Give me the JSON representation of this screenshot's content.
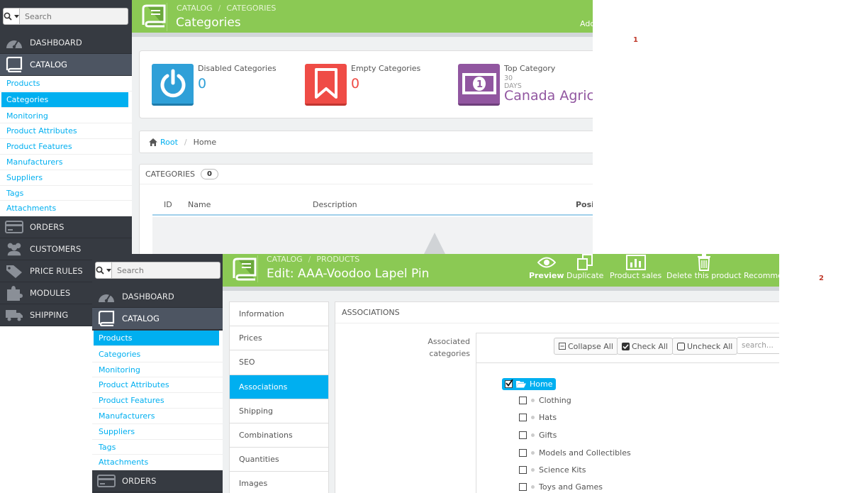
{
  "markers": [
    "1",
    "2"
  ],
  "shot1": {
    "search_placeholder": "Search",
    "menu": [
      {
        "label": "DASHBOARD",
        "icon": "dashboard-icon"
      },
      {
        "label": "CATALOG",
        "icon": "book-icon"
      }
    ],
    "submenu": [
      "Products",
      "Categories",
      "Monitoring",
      "Product Attributes",
      "Product Features",
      "Manufacturers",
      "Suppliers",
      "Tags",
      "Attachments"
    ],
    "submenu_selected": "Categories",
    "menu_bottom": [
      "ORDERS",
      "CUSTOMERS",
      "PRICE RULES",
      "MODULES",
      "SHIPPING"
    ],
    "breadcrumb": [
      "CATALOG",
      "CATEGORIES"
    ],
    "title": "Categories",
    "toolbar_partial": "Add",
    "kpis": [
      {
        "title": "Disabled Categories",
        "value": "0",
        "color": "#2fa0d8",
        "icon": "power-icon"
      },
      {
        "title": "Empty Categories",
        "value": "0",
        "color": "#ef4c46",
        "icon": "bookmark-icon"
      },
      {
        "title": "Top Category",
        "sub": "30 DAYS",
        "value": "Canada Agric..",
        "color": "#9156a0",
        "icon": "money-icon"
      }
    ],
    "path": {
      "root": "Root",
      "current": "Home"
    },
    "list": {
      "title": "CATEGORIES",
      "count": "0",
      "columns": [
        "ID",
        "Name",
        "Description",
        "Posit"
      ]
    }
  },
  "shot2": {
    "search_placeholder": "Search",
    "menu": [
      {
        "label": "DASHBOARD",
        "icon": "dashboard-icon"
      },
      {
        "label": "CATALOG",
        "icon": "book-icon"
      }
    ],
    "submenu": [
      "Products",
      "Categories",
      "Monitoring",
      "Product Attributes",
      "Product Features",
      "Manufacturers",
      "Suppliers",
      "Tags",
      "Attachments"
    ],
    "submenu_selected": "Products",
    "menu_bottom": [
      "ORDERS"
    ],
    "breadcrumb": [
      "CATALOG",
      "PRODUCTS"
    ],
    "title": "Edit: AAA-Voodoo Lapel Pin",
    "toolbar": [
      "Preview",
      "Duplicate",
      "Product sales",
      "Delete this product",
      "Recomme"
    ],
    "tabs": [
      "Information",
      "Prices",
      "SEO",
      "Associations",
      "Shipping",
      "Combinations",
      "Quantities",
      "Images"
    ],
    "tab_selected": "Associations",
    "section_title": "ASSOCIATIONS",
    "field_label": "Associated categories",
    "tree_buttons": [
      "Collapse All",
      "Check All",
      "Uncheck All"
    ],
    "tree_search_placeholder": "search...",
    "tree_root": "Home",
    "tree_items": [
      "Clothing",
      "Hats",
      "Gifts",
      "Models and Collectibles",
      "Science Kits",
      "Toys and Games"
    ]
  }
}
